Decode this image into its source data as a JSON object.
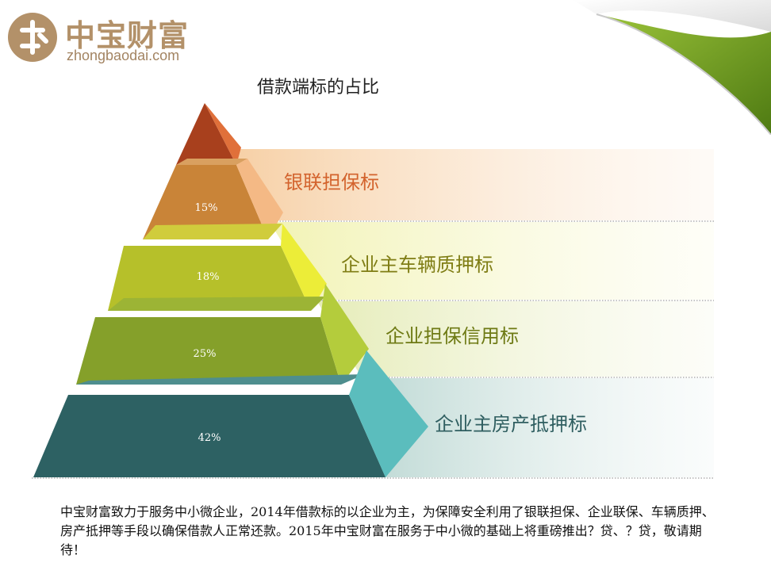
{
  "brand": {
    "name": "中宝财富",
    "domain": "zhongbaodai.com"
  },
  "colors": {
    "brand": "#b39169",
    "curl_green": "#6d9a1f",
    "tiers": [
      "#cf5a2a",
      "#cc8a3c",
      "#b4bc25",
      "#88a028",
      "#2e6264"
    ],
    "labels": [
      "#d3632d",
      "#7f7d14",
      "#6e7a14",
      "#2f5e60"
    ]
  },
  "chart_data": {
    "type": "pyramid",
    "title": "借款端标的占比",
    "categories": [
      "银联担保标",
      "企业主车辆质押标",
      "企业担保信用标",
      "企业主房产抵押标"
    ],
    "values": [
      15,
      18,
      25,
      42
    ],
    "value_labels": [
      "15%",
      "18%",
      "25%",
      "42%"
    ]
  },
  "description": "中宝财富致力于服务中小微企业，2014年借款标的以企业为主，为保障安全利用了银联担保、企业联保、车辆质押、房产抵押等手段以确保借款人正常还款。2015年中宝财富在服务于中小微的基础上将重磅推出？贷、？贷，敬请期待！"
}
